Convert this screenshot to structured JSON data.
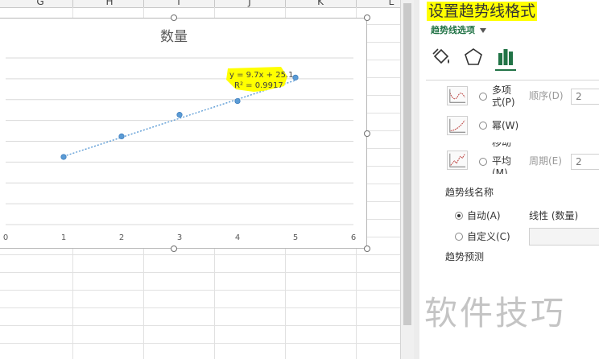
{
  "sheet": {
    "columns": [
      "G",
      "H",
      "I",
      "J",
      "K",
      "L"
    ]
  },
  "chart": {
    "title": "数量",
    "equation": "y = 9.7x + 25.1",
    "r_squared": "R² = 0.9917",
    "highlight_color": "#ffff00",
    "series_color": "#5b9bd5"
  },
  "chart_data": {
    "type": "scatter",
    "title": "数量",
    "xlabel": "",
    "ylabel": "",
    "x": [
      1,
      2,
      3,
      4,
      5
    ],
    "y": [
      34.5,
      45,
      56,
      63,
      75
    ],
    "xlim": [
      0,
      6
    ],
    "x_ticks": [
      "0",
      "1",
      "2",
      "3",
      "4",
      "5",
      "6"
    ],
    "grid": true,
    "trendline": {
      "type": "linear",
      "style": "dotted",
      "slope": 9.7,
      "intercept": 25.1,
      "r2": 0.9917
    }
  },
  "pane": {
    "title": "设置趋势线格式",
    "options_label": "趋势线选项",
    "tabs": [
      {
        "name": "fill-line",
        "icon": "paint-bucket-icon"
      },
      {
        "name": "effects",
        "icon": "pentagon-icon"
      },
      {
        "name": "options",
        "icon": "bar-chart-icon",
        "active": true
      }
    ],
    "polynomial_label_1": "多项",
    "polynomial_label_2": "式(P)",
    "order_label": "顺序(D)",
    "order_value": "2",
    "power_label": "幂(W)",
    "moving_avg_label_1": "移动",
    "moving_avg_label_2": "平均",
    "moving_avg_label_3": "(M)",
    "period_label": "周期(E)",
    "period_value": "2",
    "name_section": "趋势线名称",
    "auto_label": "自动(A)",
    "auto_value": "线性 (数量)",
    "custom_label": "自定义(C)",
    "forecast_section": "趋势预测",
    "accent_color": "#217346"
  },
  "watermark": "软件技巧"
}
